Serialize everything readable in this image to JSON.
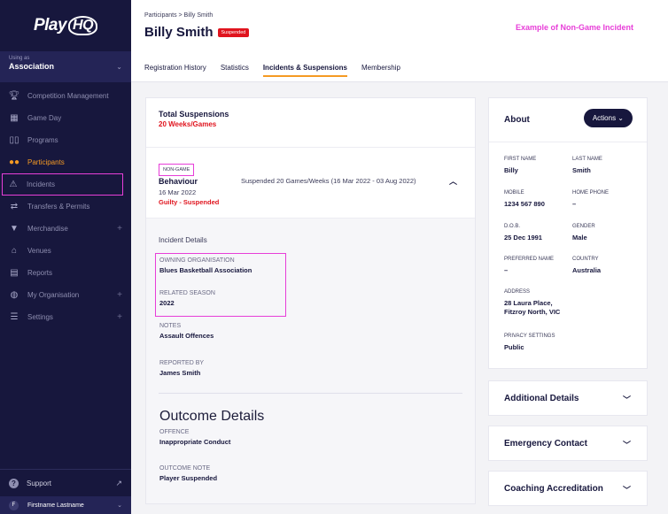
{
  "sidebar": {
    "logo": "Play",
    "logo_hq": "HQ",
    "using_as": "Using as",
    "association": "Association",
    "items": [
      {
        "label": "Competition Management",
        "icon": "trophy-icon"
      },
      {
        "label": "Game Day",
        "icon": "gameday-icon"
      },
      {
        "label": "Programs",
        "icon": "book-icon"
      },
      {
        "label": "Participants",
        "icon": "people-icon"
      },
      {
        "label": "Incidents",
        "icon": "warning-icon"
      },
      {
        "label": "Transfers & Permits",
        "icon": "transfer-icon"
      },
      {
        "label": "Merchandise",
        "icon": "shirt-icon"
      },
      {
        "label": "Venues",
        "icon": "venue-icon"
      },
      {
        "label": "Reports",
        "icon": "report-icon"
      },
      {
        "label": "My Organisation",
        "icon": "globe-icon"
      },
      {
        "label": "Settings",
        "icon": "settings-sliders-icon"
      }
    ],
    "support": "Support",
    "user": "Firstname Lastname",
    "user_initial": "F"
  },
  "header": {
    "breadcrumb": "Participants > Billy Smith",
    "title": "Billy Smith",
    "status_badge": "Suspended",
    "note": "Example of Non-Game Incident",
    "tabs": [
      "Registration History",
      "Statistics",
      "Incidents & Suspensions",
      "Membership"
    ]
  },
  "totals": {
    "label": "Total Suspensions",
    "value": "20 Weeks/Games"
  },
  "incident": {
    "type": "NON-GAME",
    "title": "Behaviour",
    "date": "16 Mar 2022",
    "status": "Guilty - Suspended",
    "summary": "Suspended 20 Games/Weeks (16 Mar 2022 - 03 Aug 2022)"
  },
  "incident_details": {
    "title": "Incident Details",
    "owning_org_label": "OWNING ORGANISATION",
    "owning_org": "Blues Basketball Association",
    "season_label": "RELATED SEASON",
    "season": "2022",
    "notes_label": "NOTES",
    "notes": "Assault Offences",
    "reported_by_label": "REPORTED BY",
    "reported_by": "James Smith"
  },
  "outcome_details": {
    "title": "Outcome Details",
    "offence_label": "OFFENCE",
    "offence": "Inappropriate Conduct",
    "note_label": "OUTCOME NOTE",
    "note": "Player Suspended"
  },
  "about": {
    "title": "About",
    "actions": "Actions",
    "first_name_label": "FIRST NAME",
    "first_name": "Billy",
    "last_name_label": "LAST NAME",
    "last_name": "Smith",
    "mobile_label": "MOBILE",
    "mobile": "1234 567 890",
    "home_phone_label": "HOME PHONE",
    "home_phone": "–",
    "dob_label": "D.O.B.",
    "dob": "25 Dec 1991",
    "gender_label": "GENDER",
    "gender": "Male",
    "preferred_label": "PREFERRED NAME",
    "preferred": "–",
    "country_label": "COUNTRY",
    "country": "Australia",
    "address_label": "ADDRESS",
    "address_line1": "28 Laura Place,",
    "address_line2": "Fitzroy North, VIC",
    "privacy_label": "PRIVACY SETTINGS",
    "privacy": "Public"
  },
  "accordions": [
    "Additional Details",
    "Emergency Contact",
    "Coaching Accreditation"
  ],
  "colors": {
    "sidebar_bg": "#17173d",
    "accent_orange": "#f59a23",
    "danger_red": "#e0141e",
    "highlight_magenta": "#e73ed8"
  }
}
